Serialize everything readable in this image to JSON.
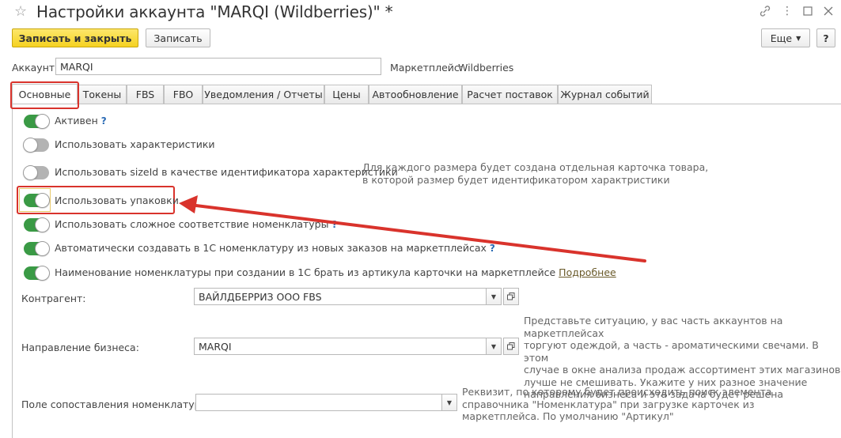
{
  "window": {
    "title": "Настройки аккаунта \"MARQI (Wildberries)\" *"
  },
  "toolbar": {
    "save_close": "Записать и закрыть",
    "save": "Записать",
    "more": "Еще",
    "help": "?"
  },
  "account": {
    "label": "Аккаунт:",
    "value": "MARQI",
    "marketplace_label": "Маркетплейс:",
    "marketplace_value": "Wildberries"
  },
  "tabs": [
    {
      "label": "Основные",
      "active": true
    },
    {
      "label": "Токены"
    },
    {
      "label": "FBS"
    },
    {
      "label": "FBO"
    },
    {
      "label": "Уведомления / Отчеты"
    },
    {
      "label": "Цены"
    },
    {
      "label": "Автообновление"
    },
    {
      "label": "Расчет поставок"
    },
    {
      "label": "Журнал событий"
    }
  ],
  "toggles": [
    {
      "label": "Активен",
      "on": true,
      "help": "?"
    },
    {
      "label": "Использовать характеристики",
      "on": false
    },
    {
      "label": "Использовать sizeId в качестве идентификатора характеристики",
      "on": false
    },
    {
      "label": "Использовать упаковки",
      "on": true
    },
    {
      "label": "Использовать сложное соответствие номенклатуры",
      "on": true,
      "help": "?"
    },
    {
      "label": "Автоматически создавать в 1С номенклатуру из новых заказов на маркетплейсах",
      "on": true,
      "help": "?"
    },
    {
      "label": "Наименование номенклатуры при создании в 1С брать из артикула карточки на маркетплейсе",
      "on": true,
      "link": "Подробнее"
    }
  ],
  "notes": {
    "sizeid_line1": "Для каждого размера будет создана отдельная карточка товара,",
    "sizeid_line2": "в которой размер будет идентификатором характристики",
    "business_lines": [
      "Представьте ситуацию, у вас часть аккаунтов на маркетплейсах",
      "торгуют одеждой, а часть - ароматическими свечами. В этом",
      "случае в окне анализа продаж ассортимент этих магазинов",
      "лучше не смешивать. Укажите у них разное значение",
      "направления бизнеса и эта задача будет решена"
    ],
    "mapping_lines": [
      "Реквизит, по которому будет происходить поиск элемента",
      "справочника \"Номенклатура\" при загрузке карточек из",
      "маркетплейса. По умолчанию \"Артикул\""
    ]
  },
  "form": {
    "counterparty_label": "Контрагент:",
    "counterparty_value": "ВАЙЛДБЕРРИЗ ООО FBS",
    "business_label": "Направление бизнеса:",
    "business_value": "MARQI",
    "mapping_label": "Поле сопоставления номенклатуры:",
    "mapping_value": ""
  },
  "colors": {
    "accent_yellow": "#f5d221",
    "toggle_on": "#3a9a45",
    "highlight_red": "#d9332c"
  }
}
